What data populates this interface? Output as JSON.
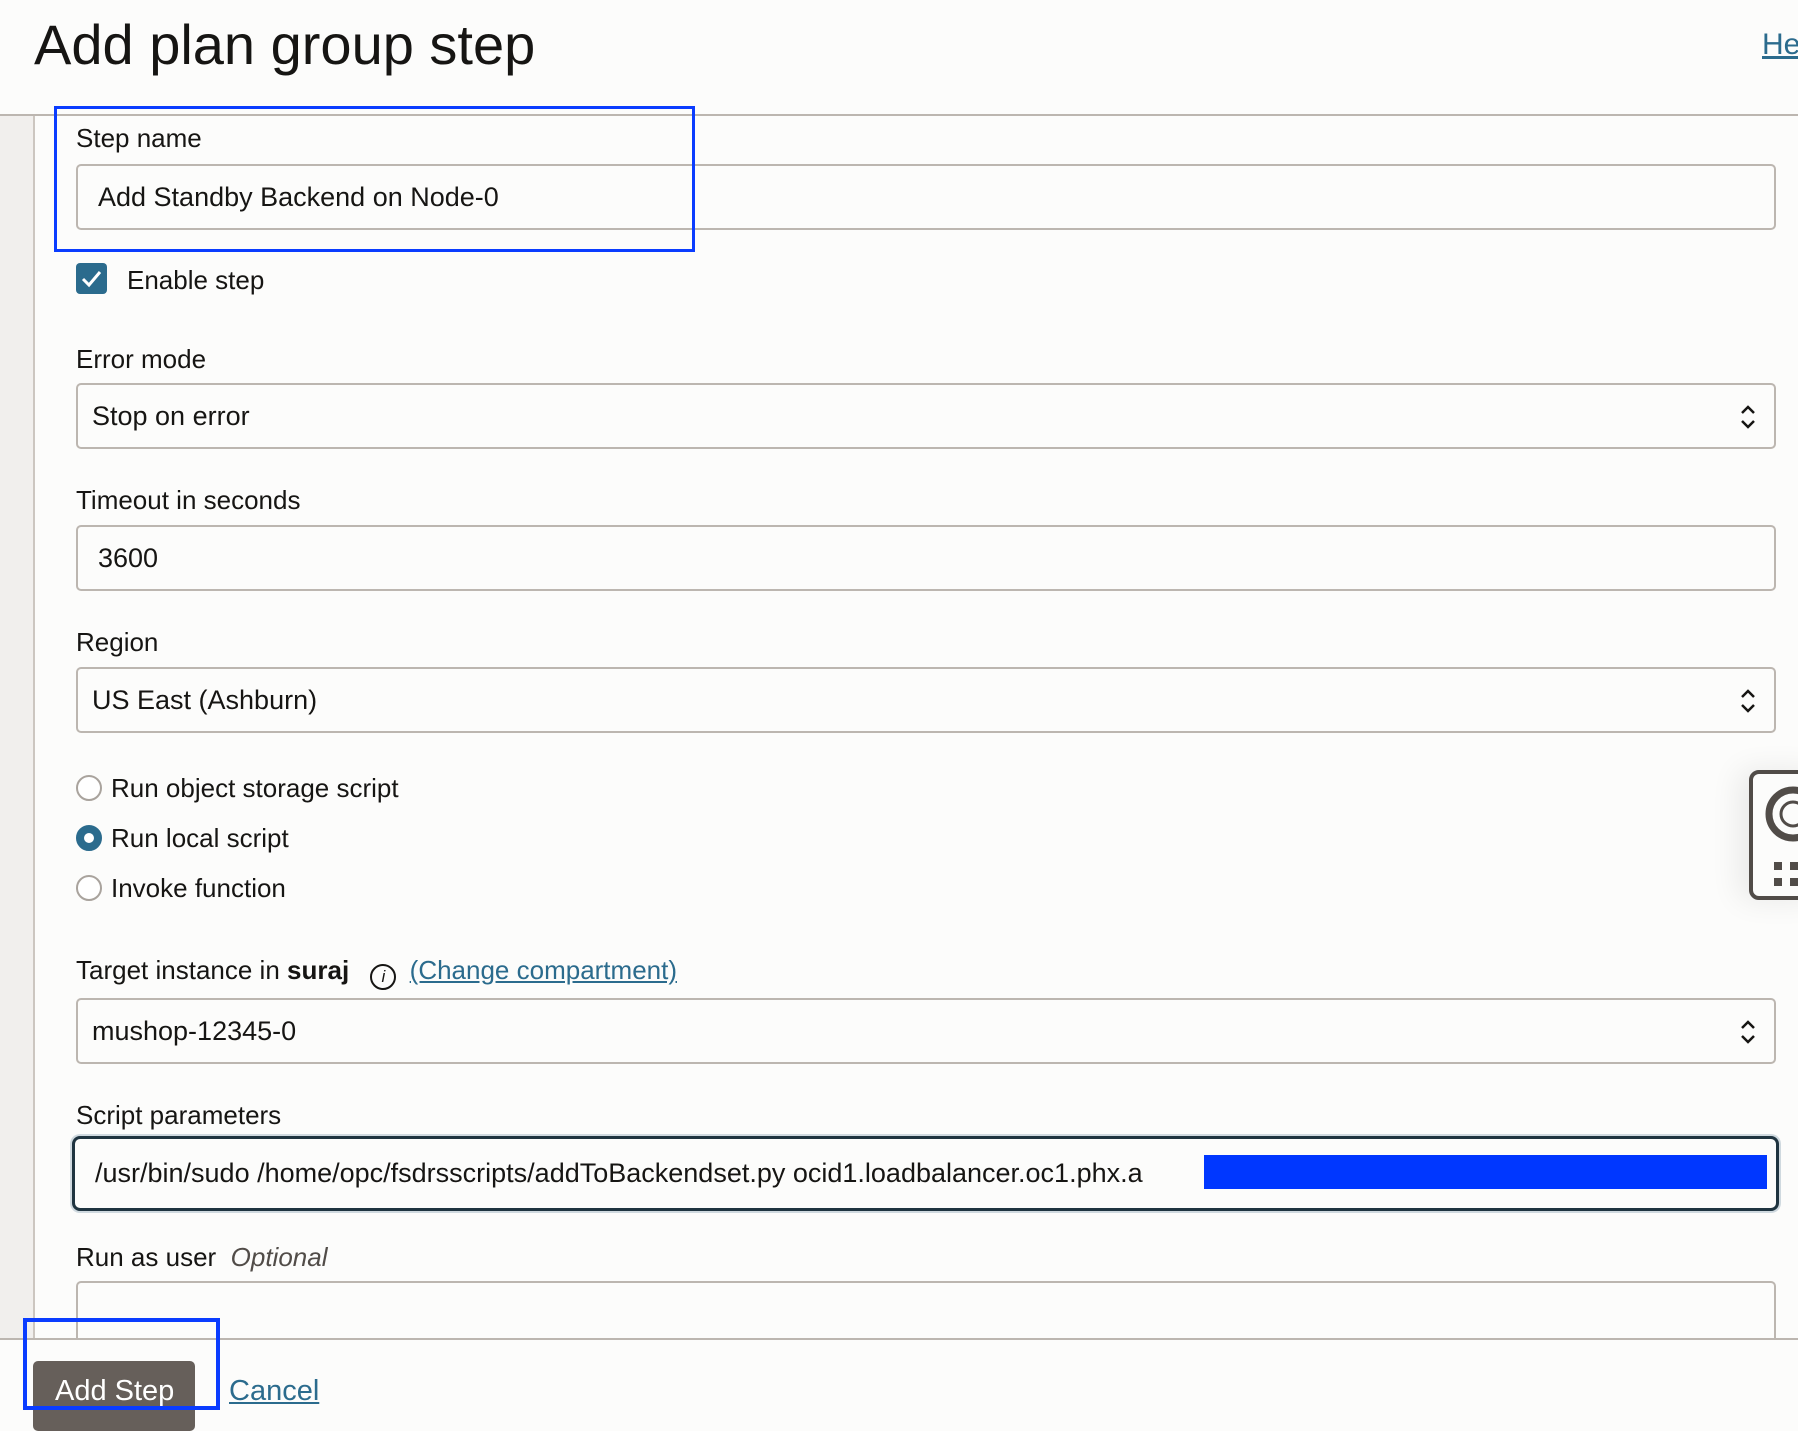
{
  "header": {
    "title": "Add plan group step",
    "help_link": "He"
  },
  "form": {
    "step_name": {
      "label": "Step name",
      "value": "Add Standby Backend on Node-0"
    },
    "enable_step": {
      "label": "Enable step",
      "checked": true
    },
    "error_mode": {
      "label": "Error mode",
      "value": "Stop on error"
    },
    "timeout": {
      "label": "Timeout in seconds",
      "value": "3600"
    },
    "region": {
      "label": "Region",
      "value": "US East (Ashburn)"
    },
    "script_type": {
      "options": [
        "Run object storage script",
        "Run local script",
        "Invoke function"
      ],
      "selected": "Run local script"
    },
    "target_instance": {
      "label_prefix": "Target instance in",
      "compartment": "suraj",
      "change_link": "(Change compartment)",
      "value": "mushop-12345-0"
    },
    "script_parameters": {
      "label": "Script parameters",
      "value": "/usr/bin/sudo /home/opc/fsdrsscripts/addToBackendset.py ocid1.loadbalancer.oc1.phx.a"
    },
    "run_as_user": {
      "label": "Run as user",
      "optional": "Optional",
      "value": ""
    }
  },
  "footer": {
    "add_label": "Add Step",
    "cancel_label": "Cancel"
  },
  "colors": {
    "accent": "#2b6b8d",
    "highlight": "#0a3cff",
    "redaction": "#0037ff"
  }
}
